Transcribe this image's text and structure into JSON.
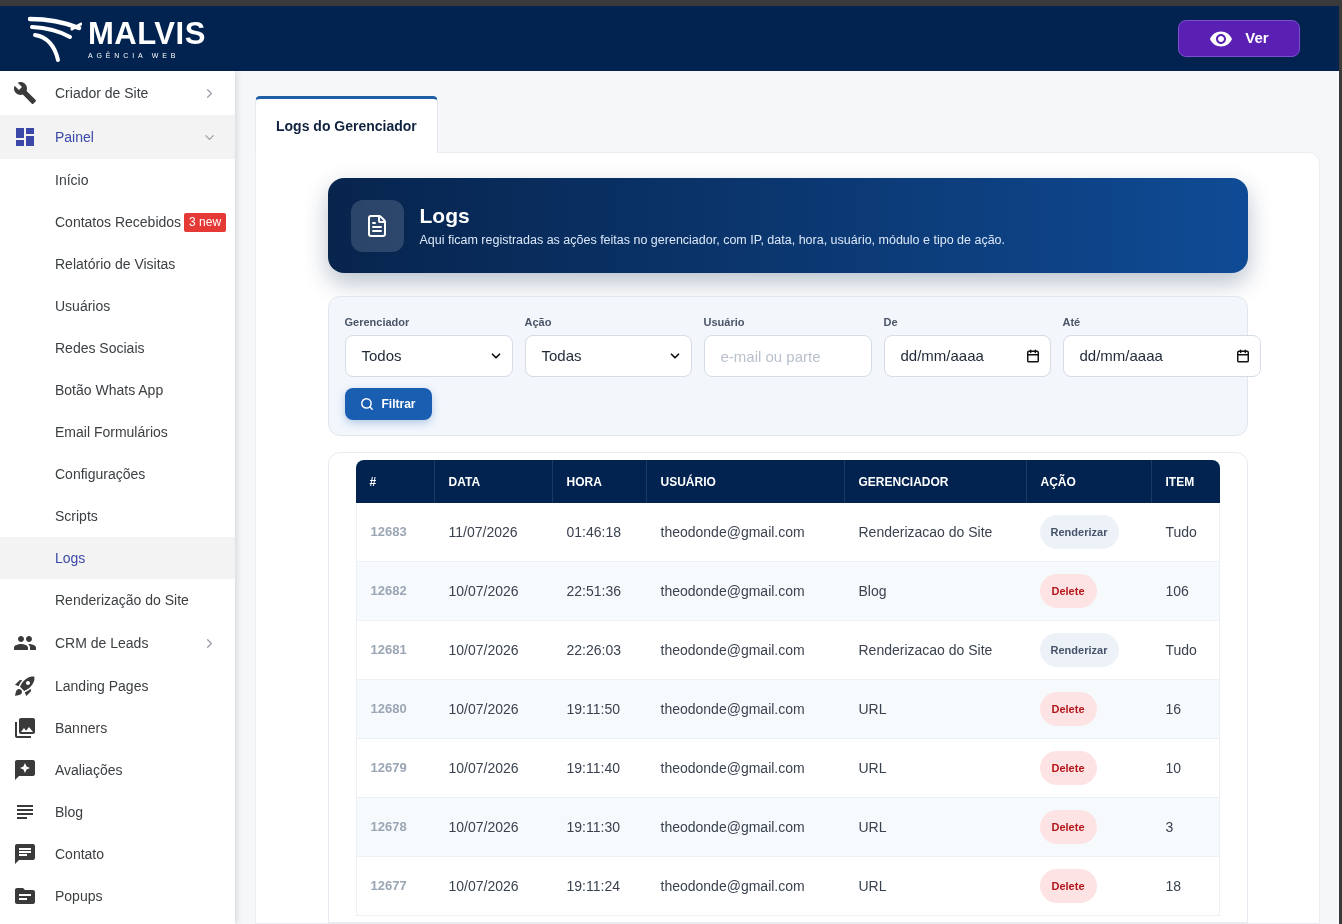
{
  "header": {
    "logo": {
      "name": "MALVIS",
      "tagline": "AGÊNCIA WEB"
    },
    "view_button": {
      "label": "Ver"
    }
  },
  "sidebar": {
    "items": [
      {
        "label": "Criador de Site",
        "selected": false,
        "expanded": false
      },
      {
        "label": "Painel",
        "selected": true,
        "expanded": true,
        "children": [
          {
            "label": "Início",
            "selected": false
          },
          {
            "label": "Contatos Recebidos",
            "selected": false,
            "badge": "3 new"
          },
          {
            "label": "Relatório de Visitas",
            "selected": false
          },
          {
            "label": "Usuários",
            "selected": false
          },
          {
            "label": "Redes Sociais",
            "selected": false
          },
          {
            "label": "Botão Whats App",
            "selected": false
          },
          {
            "label": "Email Formulários",
            "selected": false
          },
          {
            "label": "Configurações",
            "selected": false
          },
          {
            "label": "Scripts",
            "selected": false
          },
          {
            "label": "Logs",
            "selected": true
          },
          {
            "label": "Renderização do Site",
            "selected": false
          }
        ]
      },
      {
        "label": "CRM de Leads",
        "selected": false,
        "expanded": false
      },
      {
        "label": "Landing Pages",
        "selected": false
      },
      {
        "label": "Banners",
        "selected": false
      },
      {
        "label": "Avaliações",
        "selected": false
      },
      {
        "label": "Blog",
        "selected": false
      },
      {
        "label": "Contato",
        "selected": false
      },
      {
        "label": "Popups",
        "selected": false
      }
    ]
  },
  "tabs": [
    {
      "label": "Logs do Gerenciador",
      "selected": true
    }
  ],
  "banner": {
    "title": "Logs",
    "description": "Aqui ficam registradas as ações feitas no gerenciador, com IP, data, hora, usuário, módulo e tipo de ação."
  },
  "filters": {
    "fields": [
      {
        "kind": "select",
        "label": "Gerenciador",
        "value": "Todos"
      },
      {
        "kind": "select",
        "label": "Ação",
        "value": "Todas"
      },
      {
        "kind": "text",
        "label": "Usuário",
        "placeholder": "e-mail ou parte"
      },
      {
        "kind": "date",
        "label": "De",
        "placeholder": "dd/mm/aaaa"
      },
      {
        "kind": "date",
        "label": "Até",
        "placeholder": "dd/mm/aaaa"
      }
    ],
    "filter_button": {
      "label": "Filtrar"
    }
  },
  "table": {
    "columns": [
      "#",
      "DATA",
      "HORA",
      "USUÁRIO",
      "GERENCIADOR",
      "AÇÃO",
      "ITEM"
    ],
    "rows": [
      {
        "id": "12683",
        "date": "11/07/2026",
        "time": "01:46:18",
        "user": "theodonde@gmail.com",
        "manager": "Renderizacao do Site",
        "action": {
          "label": "Renderizar",
          "kind": "render"
        },
        "item": "Tudo"
      },
      {
        "id": "12682",
        "date": "10/07/2026",
        "time": "22:51:36",
        "user": "theodonde@gmail.com",
        "manager": "Blog",
        "action": {
          "label": "Delete",
          "kind": "delete"
        },
        "item": "106"
      },
      {
        "id": "12681",
        "date": "10/07/2026",
        "time": "22:26:03",
        "user": "theodonde@gmail.com",
        "manager": "Renderizacao do Site",
        "action": {
          "label": "Renderizar",
          "kind": "render"
        },
        "item": "Tudo"
      },
      {
        "id": "12680",
        "date": "10/07/2026",
        "time": "19:11:50",
        "user": "theodonde@gmail.com",
        "manager": "URL",
        "action": {
          "label": "Delete",
          "kind": "delete"
        },
        "item": "16"
      },
      {
        "id": "12679",
        "date": "10/07/2026",
        "time": "19:11:40",
        "user": "theodonde@gmail.com",
        "manager": "URL",
        "action": {
          "label": "Delete",
          "kind": "delete"
        },
        "item": "10"
      },
      {
        "id": "12678",
        "date": "10/07/2026",
        "time": "19:11:30",
        "user": "theodonde@gmail.com",
        "manager": "URL",
        "action": {
          "label": "Delete",
          "kind": "delete"
        },
        "item": "3"
      },
      {
        "id": "12677",
        "date": "10/07/2026",
        "time": "19:11:24",
        "user": "theodonde@gmail.com",
        "manager": "URL",
        "action": {
          "label": "Delete",
          "kind": "delete"
        },
        "item": "18"
      }
    ]
  }
}
